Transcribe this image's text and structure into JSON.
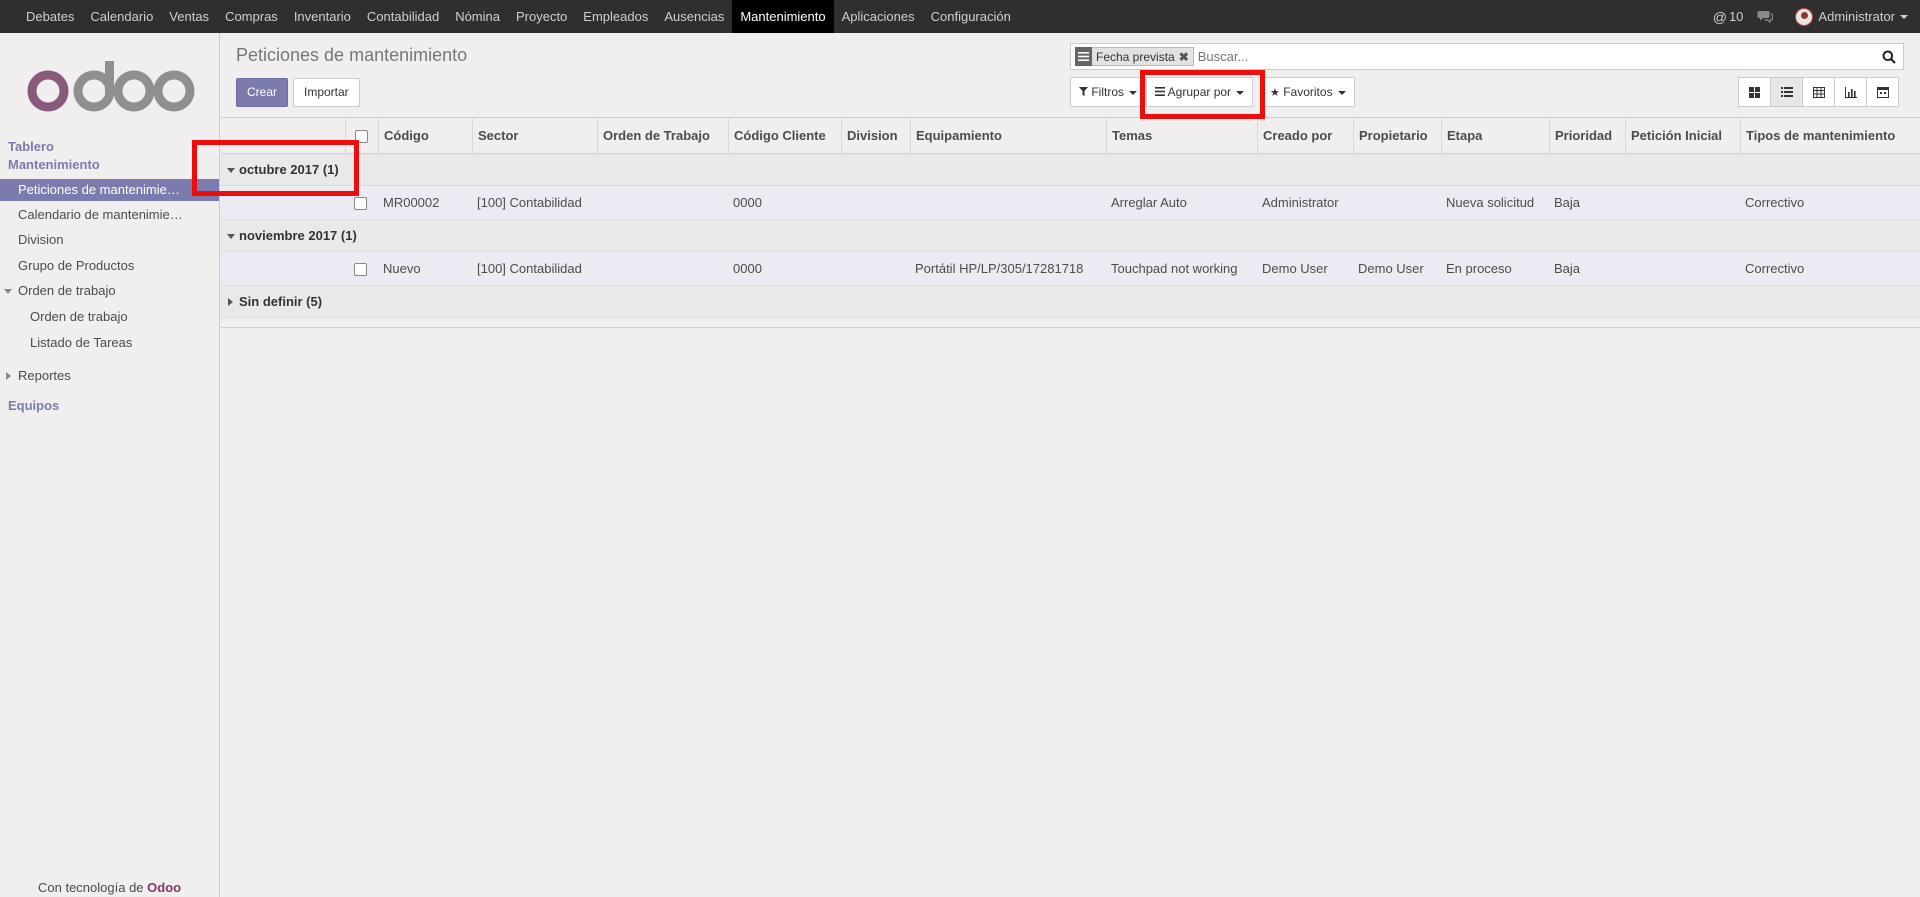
{
  "topbar": {
    "menu": [
      "Debates",
      "Calendario",
      "Ventas",
      "Compras",
      "Inventario",
      "Contabilidad",
      "Nómina",
      "Proyecto",
      "Empleados",
      "Ausencias",
      "Mantenimiento",
      "Aplicaciones",
      "Configuración"
    ],
    "active_menu": "Mantenimiento",
    "mentions_count": "10",
    "user_name": "Administrator"
  },
  "sidebar": {
    "section_dashboard": "Tablero",
    "section_maintenance": "Mantenimiento",
    "items": {
      "requests": "Peticiones de mantenimie…",
      "calendar": "Calendario de mantenimie…",
      "division": "Division",
      "product_group": "Grupo de Productos",
      "work_order": "Orden de trabajo",
      "work_order_sub": "Orden de trabajo",
      "task_list": "Listado de Tareas",
      "reports": "Reportes"
    },
    "section_teams": "Equipos",
    "powered_prefix": "Con tecnología de",
    "powered_brand": "Odoo"
  },
  "control": {
    "title": "Peticiones de mantenimiento",
    "create_label": "Crear",
    "import_label": "Importar",
    "facet_label": "Fecha prevista",
    "search_placeholder": "Buscar...",
    "filters_label": "Filtros",
    "groupby_label": "Agrupar por",
    "favorites_label": "Favoritos"
  },
  "table": {
    "columns": [
      "Código",
      "Sector",
      "Orden de Trabajo",
      "Código Cliente",
      "Division",
      "Equipamiento",
      "Temas",
      "Creado por",
      "Propietario",
      "Etapa",
      "Prioridad",
      "Petición Inicial",
      "Tipos de mantenimiento"
    ],
    "groups": [
      {
        "label": "octubre 2017 (1)",
        "expanded": true,
        "rows": [
          [
            "MR00002",
            "[100] Contabilidad",
            "",
            "0000",
            "",
            "",
            "Arreglar Auto",
            "Administrator",
            "",
            "Nueva solicitud",
            "Baja",
            "",
            "Correctivo"
          ]
        ]
      },
      {
        "label": "noviembre 2017 (1)",
        "expanded": true,
        "rows": [
          [
            "Nuevo",
            "[100] Contabilidad",
            "",
            "0000",
            "",
            "Portátil HP/LP/305/17281718",
            "Touchpad not working",
            "Demo User",
            "Demo User",
            "En proceso",
            "Baja",
            "",
            "Correctivo"
          ]
        ]
      },
      {
        "label": "Sin definir (5)",
        "expanded": false,
        "rows": []
      }
    ]
  },
  "colors": {
    "brand": "#7c7bad",
    "topbar": "#2f2f2f",
    "highlight_box": "#ee0d0d"
  }
}
